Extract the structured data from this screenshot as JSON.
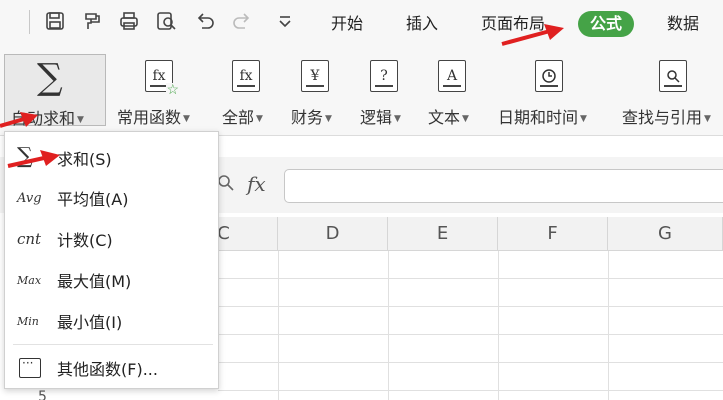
{
  "tabs": [
    {
      "label": "开始",
      "active": false
    },
    {
      "label": "插入",
      "active": false
    },
    {
      "label": "页面布局",
      "active": false
    },
    {
      "label": "公式",
      "active": true
    },
    {
      "label": "数据",
      "active": false
    }
  ],
  "quick_access": [
    "save-icon",
    "format-painter-icon",
    "print-icon",
    "print-preview-icon",
    "undo-icon",
    "redo-icon",
    "more-dropdown-icon"
  ],
  "ribbon": {
    "autosum_label": "自动求和",
    "autosum_icon": "∑",
    "groups": [
      {
        "label": "常用函数",
        "icon": "fx"
      },
      {
        "label": "全部",
        "icon": "fx"
      },
      {
        "label": "财务",
        "icon": "¥"
      },
      {
        "label": "逻辑",
        "icon": "?"
      },
      {
        "label": "文本",
        "icon": "A"
      },
      {
        "label": "日期和时间",
        "icon": "clock"
      },
      {
        "label": "查找与引用",
        "icon": "search"
      }
    ]
  },
  "formula_bar": {
    "fx_label": "fx",
    "value": ""
  },
  "columns": [
    "C",
    "D",
    "E",
    "F",
    "G"
  ],
  "row_partial_label": "5",
  "dropdown": {
    "items": [
      {
        "icon": "∑",
        "label": "求和(S)"
      },
      {
        "icon": "Avg",
        "label": "平均值(A)"
      },
      {
        "icon": "cnt",
        "label": "计数(C)"
      },
      {
        "icon": "Max",
        "label": "最大值(M)"
      },
      {
        "icon": "Min",
        "label": "最小值(I)"
      }
    ],
    "other_label": "其他函数(F)..."
  },
  "colors": {
    "active_tab": "#45a347",
    "annotation_arrow": "#e02020"
  }
}
